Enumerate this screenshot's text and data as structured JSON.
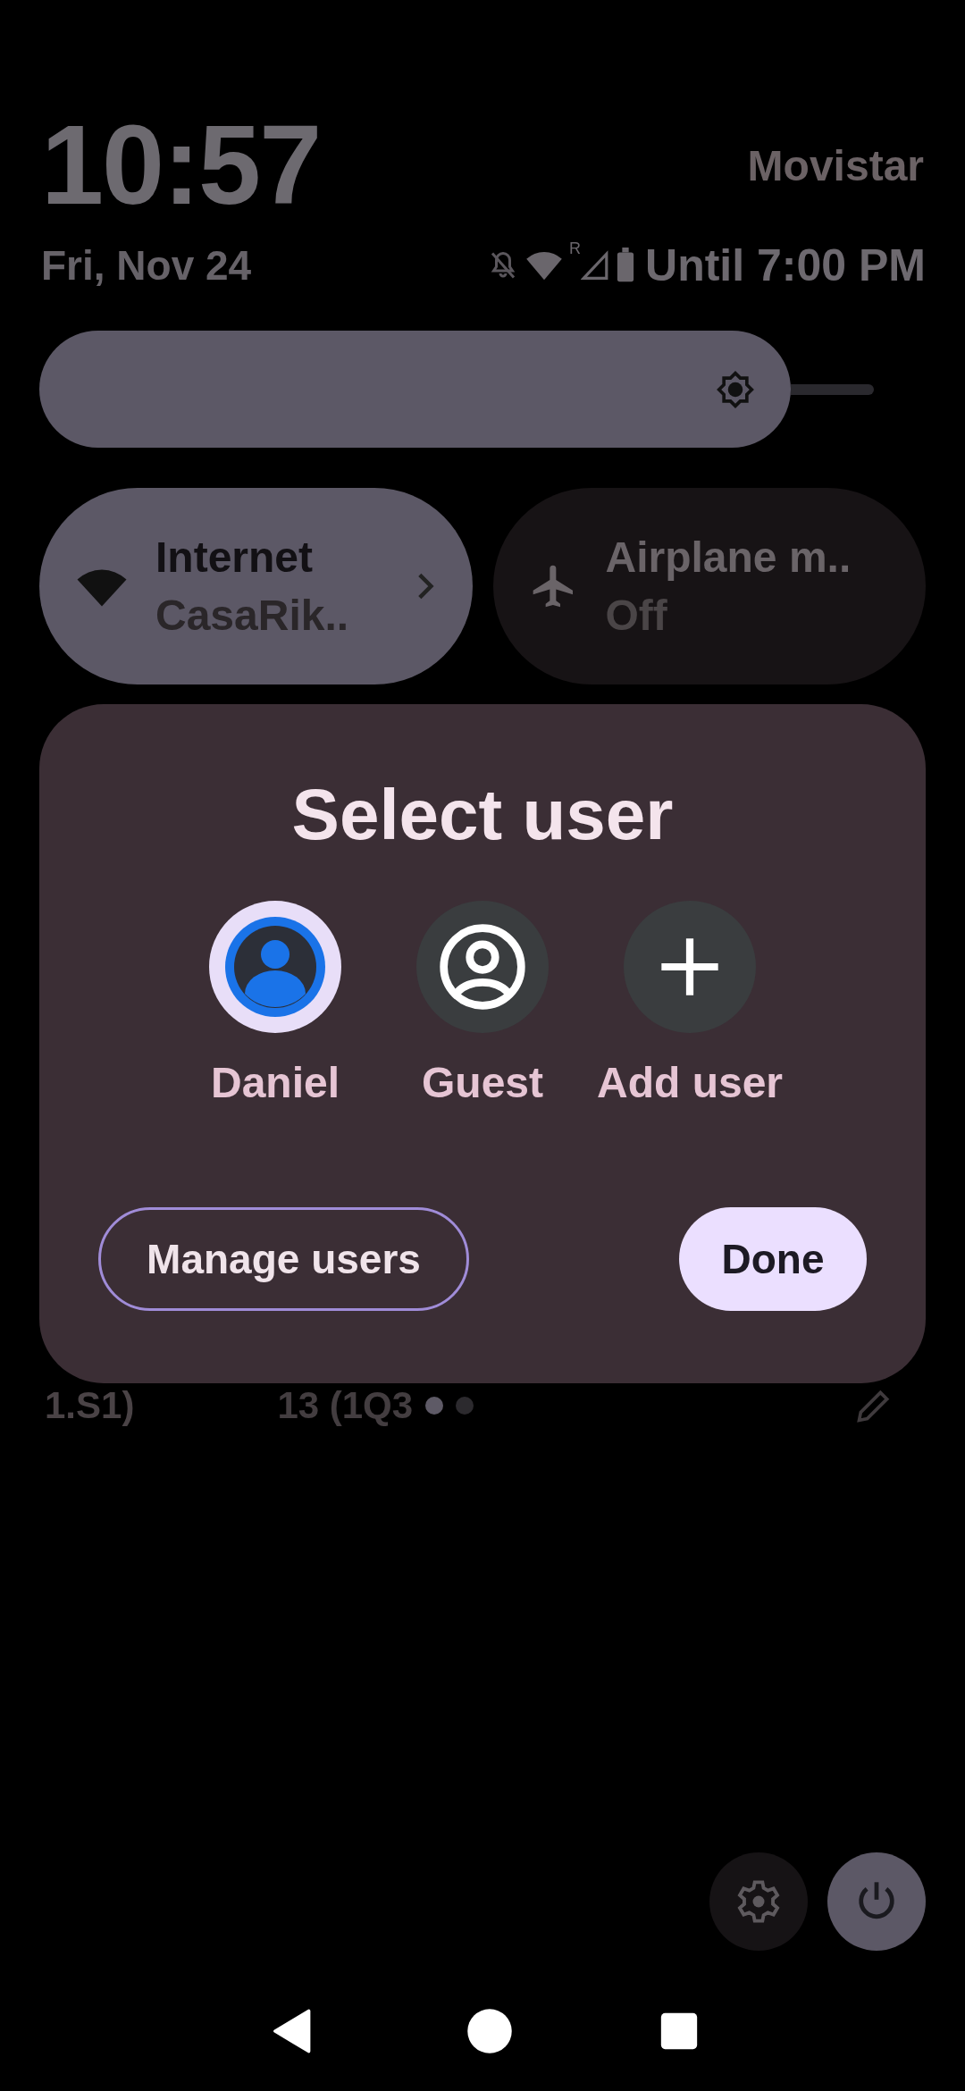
{
  "clock": {
    "time": "10:57",
    "date": "Fri, Nov 24"
  },
  "carrier": "Movistar",
  "status": {
    "roaming": "R",
    "alarm_text": "Until 7:00 PM"
  },
  "brightness": {
    "level": 0.9
  },
  "tiles": [
    {
      "kind": "internet",
      "title": "Internet",
      "subtitle": "CasaRik..",
      "on": true
    },
    {
      "kind": "airplane",
      "title": "Airplane m..",
      "subtitle": "Off",
      "on": false
    }
  ],
  "dialog": {
    "title": "Select user",
    "users": [
      {
        "kind": "user",
        "name": "Daniel",
        "selected": true
      },
      {
        "kind": "guest",
        "name": "Guest",
        "selected": false
      },
      {
        "kind": "add",
        "name": "Add user",
        "selected": false
      }
    ],
    "buttons": [
      {
        "kind": "outlined",
        "label": "Manage users"
      },
      {
        "kind": "filled",
        "label": "Done"
      }
    ]
  },
  "footer": {
    "build_left": "1.S1)",
    "build_right": "13 (1Q3",
    "pages": [
      {
        "selected": true
      },
      {
        "selected": false
      }
    ]
  },
  "quick_buttons": [
    {
      "kind": "settings"
    },
    {
      "kind": "power"
    }
  ]
}
